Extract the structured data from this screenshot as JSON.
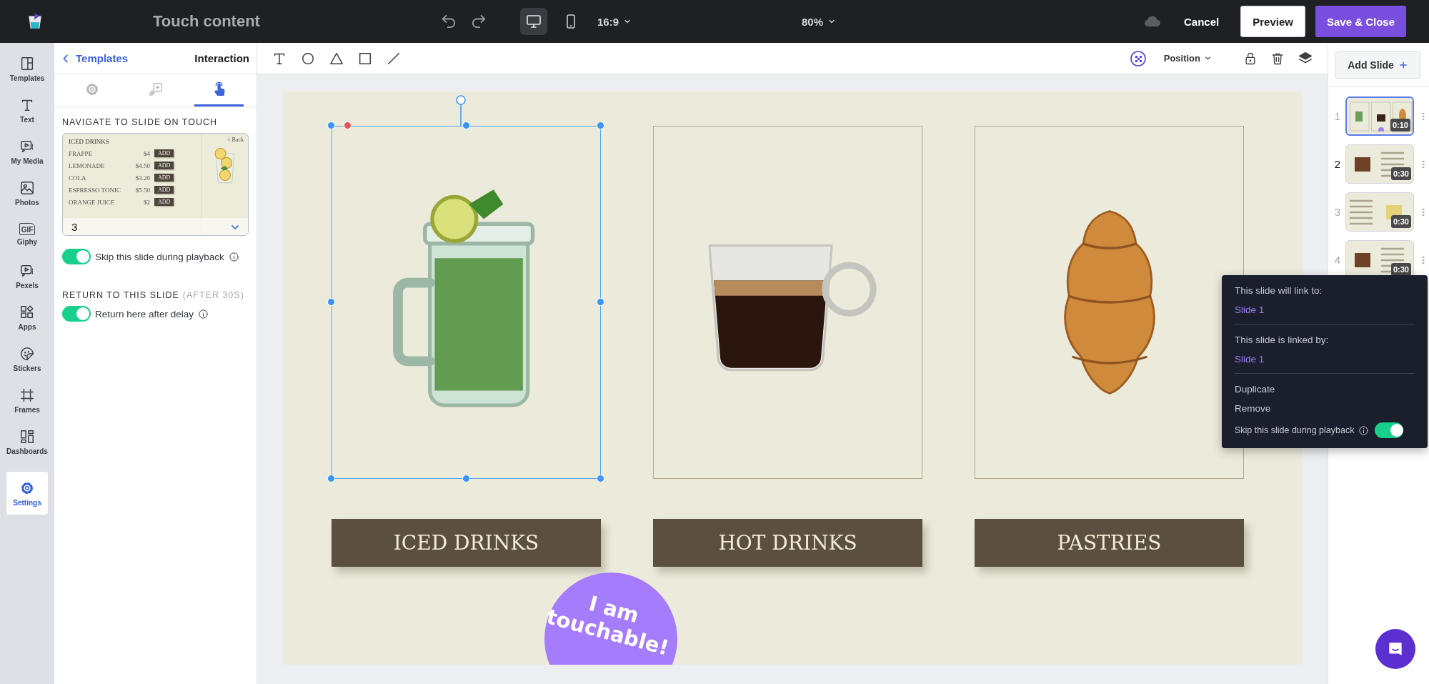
{
  "app_bar": {
    "title": "Touch content",
    "devices": [
      {
        "kind": "desktop",
        "selected": true
      },
      {
        "kind": "phone",
        "selected": false
      }
    ],
    "aspect": "16:9",
    "zoom": "80%",
    "buttons": [
      {
        "label": "Cancel",
        "kind": "text"
      },
      {
        "label": "Preview",
        "kind": "outline"
      },
      {
        "label": "Save & Close",
        "kind": "primary"
      }
    ]
  },
  "sidebar": {
    "items": [
      {
        "label": "Templates",
        "kind": "templates",
        "selected": false
      },
      {
        "label": "Text",
        "kind": "text",
        "selected": false
      },
      {
        "label": "My Media",
        "kind": "media",
        "selected": false
      },
      {
        "label": "Photos",
        "kind": "photos",
        "selected": false
      },
      {
        "label": "Giphy",
        "kind": "gif",
        "icon_text": "GIF",
        "selected": false
      },
      {
        "label": "Pexels",
        "kind": "media",
        "selected": false
      },
      {
        "label": "Apps",
        "kind": "apps",
        "selected": false
      },
      {
        "label": "Stickers",
        "kind": "stickers",
        "selected": false
      },
      {
        "label": "Frames",
        "kind": "frames",
        "selected": false
      },
      {
        "label": "Dashboards",
        "kind": "dashboards",
        "selected": false
      },
      {
        "label": "Settings",
        "kind": "settings",
        "selected": true
      }
    ]
  },
  "panel": {
    "back_label": "Templates",
    "title": "Interaction",
    "tabs": [
      {
        "kind": "gear",
        "selected": false
      },
      {
        "kind": "animate",
        "selected": false
      },
      {
        "kind": "touch",
        "selected": true
      }
    ],
    "navigate_heading": "NAVIGATE TO SLIDE ON TOUCH",
    "target_preview": {
      "title": "ICED DRINKS",
      "back": "< Back",
      "slide_number": "3",
      "rows": [
        {
          "name": "FRAPPE",
          "price": "$4",
          "button": "ADD"
        },
        {
          "name": "LEMONADE",
          "price": "$4.50",
          "button": "ADD"
        },
        {
          "name": "COLA",
          "price": "$3.20",
          "button": "ADD"
        },
        {
          "name": "ESPRESSO TONIC",
          "price": "$5.50",
          "button": "ADD"
        },
        {
          "name": "ORANGE JUICE",
          "price": "$2",
          "button": "ADD"
        }
      ]
    },
    "skip_toggle": {
      "label": "Skip this slide during playback",
      "on": true
    },
    "return_heading": "RETURN TO THIS SLIDE",
    "return_note": "(AFTER 30S)",
    "return_toggle": {
      "label": "Return here after delay",
      "on": true
    }
  },
  "canvas_toolbar": {
    "tools": [
      {
        "kind": "text"
      },
      {
        "kind": "circle"
      },
      {
        "kind": "triangle"
      },
      {
        "kind": "square"
      },
      {
        "kind": "line"
      }
    ],
    "position": "Position"
  },
  "slide": {
    "cards": [
      {
        "label": "ICED DRINKS",
        "kind": "jar",
        "selected": true
      },
      {
        "label": "HOT DRINKS",
        "kind": "cup",
        "selected": false
      },
      {
        "label": "PASTRIES",
        "kind": "croissant",
        "selected": false
      }
    ],
    "sticker": "I am touchable!"
  },
  "slides_panel": {
    "add_label": "Add Slide",
    "slides": [
      {
        "number": "1",
        "duration": "0:10",
        "kind": "grid",
        "selected": true,
        "menu_open": false
      },
      {
        "number": "2",
        "duration": "0:30",
        "kind": "photo-left",
        "selected": false,
        "menu_open": true
      },
      {
        "number": "3",
        "duration": "0:30",
        "kind": "photo-right",
        "selected": false,
        "menu_open": false
      },
      {
        "number": "4",
        "duration": "0:30",
        "kind": "photo-left",
        "selected": false,
        "menu_open": false
      }
    ]
  },
  "slide_menu": {
    "link_to_label": "This slide will link to:",
    "link_to": "Slide 1",
    "linked_by_label": "This slide is linked by:",
    "linked_by": "Slide 1",
    "actions": [
      "Duplicate",
      "Remove"
    ],
    "skip_label": "Skip this slide during playback",
    "skip_on": true
  }
}
